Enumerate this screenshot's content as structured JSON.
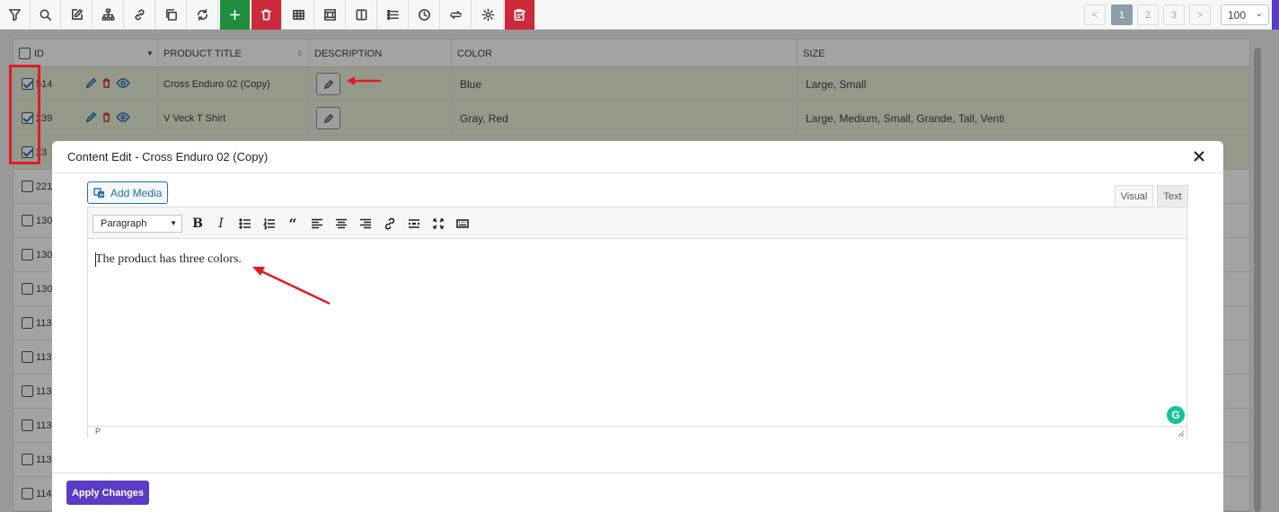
{
  "toolbar": {
    "buttons": [
      "filter-icon",
      "search-icon",
      "edit-icon",
      "sitemap-icon",
      "link-icon",
      "copy-icon",
      "refresh-icon",
      "plus-icon",
      "trash-icon",
      "table-icon",
      "columns-icon",
      "split-icon",
      "list-icon",
      "clock-icon",
      "swap-icon",
      "settings-icon",
      "clipboard-edit-icon"
    ],
    "pagination": {
      "prev": "<",
      "pages": [
        "1",
        "2",
        "3"
      ],
      "next": ">",
      "active": "1"
    },
    "per_page": "100"
  },
  "table": {
    "headers": {
      "id": "ID",
      "product_title": "PRODUCT TITLE",
      "description": "DESCRIPTION",
      "color": "COLOR",
      "size": "SIZE"
    },
    "rows": [
      {
        "id": "514",
        "title": "Cross Enduro 02 (Copy)",
        "color": "Blue",
        "size": "Large, Small",
        "checked": true
      },
      {
        "id": "239",
        "title": "V Veck T Shirt",
        "color": "Gray, Red",
        "size": "Large, Medium, Small, Grande, Tall, Venti",
        "checked": true
      },
      {
        "id": "23",
        "checked": true
      },
      {
        "id": "221",
        "checked": false
      },
      {
        "id": "130",
        "checked": false
      },
      {
        "id": "130",
        "checked": false
      },
      {
        "id": "130",
        "checked": false
      },
      {
        "id": "113",
        "checked": false
      },
      {
        "id": "113",
        "checked": false
      },
      {
        "id": "113",
        "checked": false
      },
      {
        "id": "113",
        "checked": false
      },
      {
        "id": "113",
        "checked": false
      },
      {
        "id": "114",
        "checked": false
      }
    ]
  },
  "modal": {
    "title": "Content Edit - Cross Enduro 02 (Copy)",
    "add_media": "Add Media",
    "tabs": {
      "visual": "Visual",
      "text": "Text"
    },
    "format": "Paragraph",
    "content": "The product has three colors.",
    "status_path": "P",
    "grammarly": "G",
    "apply": "Apply Changes"
  },
  "colors": {
    "accent": "#5b3cc4",
    "green": "#1e8e3e",
    "red": "#cc2a3a",
    "selected_row": "#eaf0d8",
    "annotation": "#e01b24"
  }
}
